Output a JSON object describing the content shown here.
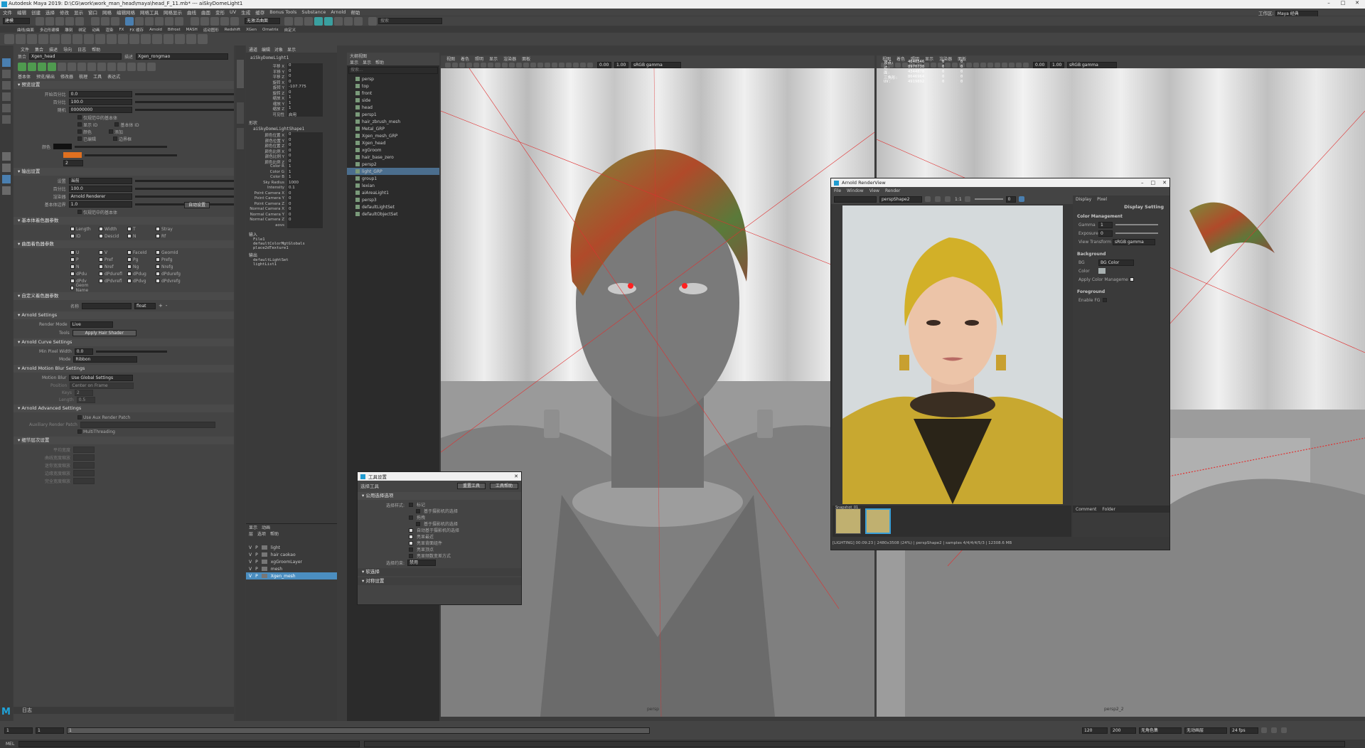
{
  "title_bar": {
    "text": "Autodesk Maya 2019: D:\\CG\\work\\work_man_head\\maya\\head_F_11.mb* --- aiSkyDomeLight1"
  },
  "menubar": {
    "items": [
      "文件",
      "编辑",
      "创建",
      "选择",
      "修改",
      "显示",
      "窗口",
      "网格",
      "编辑网格",
      "网格工具",
      "网格显示",
      "曲线",
      "曲面",
      "变形",
      "UV",
      "生成",
      "缓存",
      "Bonus Tools",
      "Substance",
      "Arnold",
      "帮助"
    ],
    "workspace_label": "工作区:",
    "workspace_value": "Maya 经典"
  },
  "status_line": {
    "menuset": "建模",
    "live": "无激活曲面",
    "search_placeholder": "搜索"
  },
  "shelf_tabs": [
    "曲线/曲面",
    "多边形建模",
    "雕刻",
    "绑定",
    "动画",
    "渲染",
    "FX",
    "FX 缓存",
    "Arnold",
    "Bifrost",
    "MASH",
    "运动图形",
    "Redshift",
    "XGen",
    "Ornatrix",
    "自定义"
  ],
  "xgen_panel": {
    "menus": [
      "文件",
      "集合",
      "描述",
      "导向",
      "日志",
      "帮助"
    ],
    "collection_label": "集合",
    "collection_value": "Xgen_head",
    "description_label": "描述",
    "description_value": "Xgen_rongmao",
    "tabs": [
      "基本体",
      "预览/输出",
      "修改器",
      "梳理",
      "工具",
      "表达式"
    ],
    "sec_preview": "预览设置",
    "preview_rows": [
      {
        "label": "开始百分比",
        "value": "0.0"
      },
      {
        "label": "百分比",
        "value": "100.0"
      },
      {
        "label": "随机",
        "value": "00000000"
      }
    ],
    "clamp_label": "仅规范中的基本体",
    "sample_rows": [
      [
        "显示 ID",
        "基本体 ID"
      ],
      [
        "颜色",
        "添加"
      ],
      [
        "已编辑",
        "边界框"
      ]
    ],
    "color_label": "颜色",
    "sec_output": "输出设置",
    "output_rows": [
      {
        "label": "设置",
        "value": "当前"
      },
      {
        "label": "百分比",
        "value": "100.0"
      },
      {
        "label": "渲染器",
        "value": "Arnold Renderer"
      },
      {
        "label": "基本体边界",
        "value": "1.0"
      }
    ],
    "auto_button": "自动设置",
    "sec_base": "基本体着色器参数",
    "base_params": [
      "Length",
      "Width",
      "T",
      "Stray",
      "ID",
      "Descid",
      "N",
      "Rf"
    ],
    "sec_surface": "曲面着色器参数",
    "surface_params": [
      "U",
      "V",
      "FaceId",
      "GeomId",
      "P",
      "Pref",
      "Pg",
      "Prefg",
      "N",
      "Nref",
      "Ng",
      "Nrefg",
      "dPdu",
      "dPdurefl",
      "dPdug",
      "dPdurefg",
      "dPdv",
      "dPdvrefl",
      "dPdvg",
      "dPdvrefg",
      "Geom Name"
    ],
    "sec_custom": "自定义着色器参数",
    "custom_name_label": "名称",
    "custom_type": "float",
    "sec_arnold": "Arnold Settings",
    "render_mode_label": "Render Mode",
    "render_mode_value": "Live",
    "tools_label": "Tools",
    "hair_shader_button": "Apply Hair Shader",
    "sec_curve": "Arnold Curve Settings",
    "min_pixel_label": "Min Pixel Width",
    "min_pixel_value": "0.0",
    "mode_label": "Mode",
    "mode_value": "Ribbon",
    "sec_motion": "Arnold Motion Blur Settings",
    "motion_label": "Motion Blur",
    "motion_value": "Use Global Settings",
    "position_label": "Position",
    "position_value": "Center on Frame",
    "keys_label": "Keys",
    "keys_value": "2",
    "length_label": "Length",
    "length_value": "0.5",
    "sec_advanced": "Arnold Advanced Settings",
    "aux_label": "Use Aux Render Patch",
    "aux_path_label": "Auxiliary Render Patch",
    "multithread_label": "MultiThreading",
    "sec_smooth": "细节层次设置",
    "smooth_rows": [
      "平均宽度",
      "曲线宽度缩放",
      "迷你宽度缩放",
      "边缘宽度缩放",
      "完全宽度缩放"
    ],
    "log_label": "日志"
  },
  "channel_box": {
    "menus": [
      "通道",
      "编辑",
      "对象",
      "显示"
    ],
    "node": "aiSkyDomeLight1",
    "channels": [
      {
        "name": "平移 X",
        "value": "0"
      },
      {
        "name": "平移 Y",
        "value": "0"
      },
      {
        "name": "平移 Z",
        "value": "0"
      },
      {
        "name": "旋转 X",
        "value": "0"
      },
      {
        "name": "旋转 Y",
        "value": "-107.775"
      },
      {
        "name": "旋转 Z",
        "value": "0"
      },
      {
        "name": "缩放 X",
        "value": "1"
      },
      {
        "name": "缩放 Y",
        "value": "1"
      },
      {
        "name": "缩放 Z",
        "value": "1"
      },
      {
        "name": "可见性",
        "value": "启用"
      }
    ],
    "shapes_label": "形状",
    "shape_node": "aiSkyDomeLightShape1",
    "shape_channels": [
      {
        "name": "颜色位置 X",
        "value": "0"
      },
      {
        "name": "颜色位置 Y",
        "value": "0"
      },
      {
        "name": "颜色位置 Z",
        "value": "0"
      },
      {
        "name": "颜色比例 X",
        "value": "0"
      },
      {
        "name": "颜色比例 Y",
        "value": "0"
      },
      {
        "name": "颜色比例 Z",
        "value": "0"
      },
      {
        "name": "Color R",
        "value": "1"
      },
      {
        "name": "Color G",
        "value": "1"
      },
      {
        "name": "Color B",
        "value": "1"
      },
      {
        "name": "Sky Radius",
        "value": "1000"
      },
      {
        "name": "Intensity",
        "value": "0.1"
      },
      {
        "name": "Point Camera X",
        "value": "0"
      },
      {
        "name": "Point Camera Y",
        "value": "0"
      },
      {
        "name": "Point Camera Z",
        "value": "0"
      },
      {
        "name": "Normal Camera X",
        "value": "0"
      },
      {
        "name": "Normal Camera Y",
        "value": "0"
      },
      {
        "name": "Normal Camera Z",
        "value": "0"
      },
      {
        "name": "aovs",
        "value": ""
      }
    ],
    "inputs_label": "输入",
    "inputs": [
      "File1",
      "defaultColorMgtGlobals",
      "place2dTexture1"
    ],
    "outputs_label": "输出",
    "outputs": [
      "defaultLightSet",
      "lightList1"
    ]
  },
  "outliner": {
    "title": "大纲视图",
    "menus": [
      "显示",
      "显示",
      "帮助"
    ],
    "search_placeholder": "搜索...",
    "items": [
      "persp",
      "top",
      "front",
      "side",
      "head",
      "persp1",
      "hair_zbrush_mesh",
      "Metal_GRP",
      "Xgen_mesh_GRP",
      "Xgen_head",
      "xgGroom",
      "hair_base_zero",
      "persp2",
      "light_GRP",
      "group1",
      "lexian",
      "aiAreaLight1",
      "persp3",
      "defaultLightSet",
      "defaultObjectSet"
    ],
    "selected": "light_GRP"
  },
  "layer_editor": {
    "tabs": [
      "显示",
      "动画"
    ],
    "menus": [
      "层",
      "选项",
      "帮助"
    ],
    "layers": [
      {
        "v": "V",
        "p": "P",
        "name": "light"
      },
      {
        "v": "V",
        "p": "P",
        "name": "hair caokao"
      },
      {
        "v": "V",
        "p": "P",
        "name": "xgGroomLayer"
      },
      {
        "v": "V",
        "p": "P",
        "name": "mesh"
      },
      {
        "v": "V",
        "p": "P",
        "name": "Xgen_mesh"
      }
    ],
    "selected": "Xgen_mesh"
  },
  "tool_settings": {
    "title": "工具设置",
    "tool_name": "选择工具",
    "reset_button": "重置工具",
    "help_button": "工具帮助",
    "sec_common": "公用选择选项",
    "select_style_label": "选择样式:",
    "options": [
      "标记",
      "基于摄影机的选择",
      "拖拽",
      "基于摄影机的选择",
      "自动基于摄影机的选择",
      "亮显最近",
      "亮显背面组件",
      "亮显顶点",
      "亮显频数变差方式"
    ],
    "constraint_label": "选择约束:",
    "constraint_value": "禁用",
    "soft_select": "软选择",
    "symmetry": "对称设置"
  },
  "viewport_left": {
    "menus": [
      "视图",
      "着色",
      "照明",
      "显示",
      "渲染器",
      "面板"
    ],
    "exposure": "0.00",
    "gamma": "1.00",
    "color_space": "sRGB gamma",
    "camera_label": "persp"
  },
  "viewport_right": {
    "menus": [
      "视图",
      "着色",
      "照明",
      "显示",
      "渲染器",
      "面板"
    ],
    "exposure": "0.00",
    "gamma": "1.00",
    "color_space": "sRGB gamma",
    "camera_label": "persp2_2",
    "stats": [
      {
        "name": "顶点:",
        "v1": "4640546",
        "v2": "0",
        "v3": "0"
      },
      {
        "name": "边:",
        "v1": "8970738",
        "v2": "0",
        "v3": "0"
      },
      {
        "name": "面:",
        "v1": "4344878",
        "v2": "0",
        "v3": "0"
      },
      {
        "name": "三角形:",
        "v1": "8646964",
        "v2": "0",
        "v3": "0"
      },
      {
        "name": "UV:",
        "v1": "4919892",
        "v2": "0",
        "v3": "0"
      }
    ]
  },
  "render_view": {
    "title": "Arnold RenderView",
    "menus": [
      "File",
      "Window",
      "View",
      "Render"
    ],
    "camera": "perspShape2",
    "ratio": "1:1",
    "exposure": "0",
    "display_tabs": [
      "Display",
      "Pixel"
    ],
    "panel_title": "Display Setting",
    "color_mgmt_title": "Color Management",
    "gamma_label": "Gamma",
    "gamma_value": "1",
    "exposure_label": "Exposure",
    "exposure_value": "0",
    "view_transform_label": "View Transform",
    "view_transform_value": "sRGB gamma",
    "background_title": "Background",
    "bg_label": "BG",
    "bg_value": "BG Color",
    "color_label": "Color",
    "apply_cm_label": "Apply Color Manageme",
    "foreground_title": "Foreground",
    "enable_fg_label": "Enable FG",
    "snapshot_label": "Snapshot_01",
    "comment_tabs": [
      "Comment",
      "Folder"
    ],
    "status": "[LIGHTING]  00:09:23 | 2480x3508 (24%) | perspShape2 | samples 4/4/4/4/5/3 | 12308.6 MB"
  },
  "timeline": {
    "start": "1",
    "current": "1",
    "frame_box": "1",
    "end_marker": "120",
    "range_start": "120",
    "range_end": "200",
    "char_set": "无角色集",
    "anim_layer": "无动画层",
    "fps": "24 fps"
  },
  "command_line": {
    "label": "MEL"
  }
}
